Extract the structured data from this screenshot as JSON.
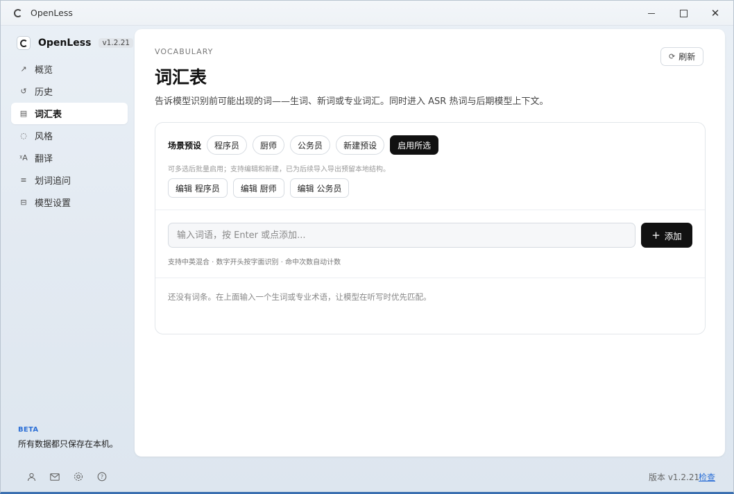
{
  "window": {
    "title": "OpenLess"
  },
  "sidebar": {
    "brand": "OpenLess",
    "version_badge": "v1.2.21",
    "items": [
      {
        "label": "概览",
        "icon": "trend-icon"
      },
      {
        "label": "历史",
        "icon": "history-icon"
      },
      {
        "label": "词汇表",
        "icon": "glossary-icon",
        "active": true
      },
      {
        "label": "风格",
        "icon": "palette-icon"
      },
      {
        "label": "翻译",
        "icon": "translate-icon"
      },
      {
        "label": "划词追问",
        "icon": "selection-icon"
      },
      {
        "label": "模型设置",
        "icon": "model-icon"
      }
    ],
    "beta_label": "BETA",
    "local_note": "所有数据都只保存在本机。",
    "footer_icons": [
      "user-icon",
      "mail-icon",
      "settings-icon",
      "help-icon"
    ]
  },
  "main": {
    "eyebrow": "VOCABULARY",
    "title": "词汇表",
    "description": "告诉模型识别前可能出现的词——生词、新词或专业词汇。同时进入 ASR 热词与后期模型上下文。",
    "refresh_label": "刷新",
    "presets": {
      "label": "场景预设",
      "chips": [
        "程序员",
        "厨师",
        "公务员",
        "新建预设"
      ],
      "enable_label": "启用所选",
      "hint": "可多选后批量启用；支持编辑和新建，已为后续导入导出预留本地结构。",
      "edit_buttons": [
        "编辑 程序员",
        "编辑 厨师",
        "编辑 公务员"
      ]
    },
    "input": {
      "placeholder": "输入词语，按 Enter 或点添加...",
      "value": "",
      "add_label": "添加",
      "hint": "支持中英混合 · 数字开头按字面识别 · 命中次数自动计数"
    },
    "empty_state": "还没有词条。在上面输入一个生词或专业术语，让模型在听写时优先匹配。"
  },
  "footer": {
    "version_text": "版本 v1.2.21",
    "check_label": "检查"
  },
  "colors": {
    "accent": "#2c6fd6",
    "primary_button": "#111111"
  }
}
